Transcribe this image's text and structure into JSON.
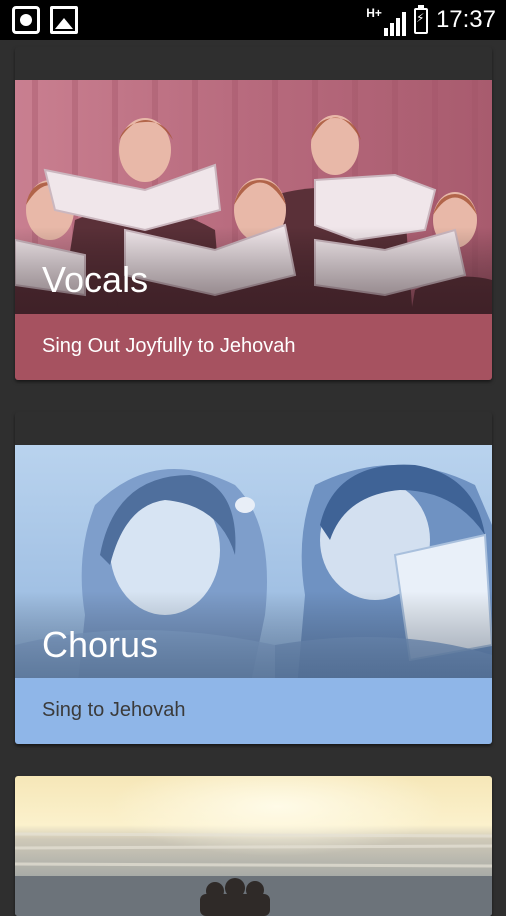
{
  "status_bar": {
    "network": "H+",
    "time": "17:37",
    "icons": [
      "record-icon",
      "image-icon",
      "signal-icon",
      "battery-charging-icon"
    ]
  },
  "cards": [
    {
      "title": "Vocals",
      "subtitle": "Sing Out Joyfully to Jehovah",
      "strip_color": "#a65260",
      "subtitle_color": "#ffffff"
    },
    {
      "title": "Chorus",
      "subtitle": "Sing to Jehovah",
      "strip_color": "#8fb6e8",
      "subtitle_color": "#3b3b3b"
    }
  ]
}
